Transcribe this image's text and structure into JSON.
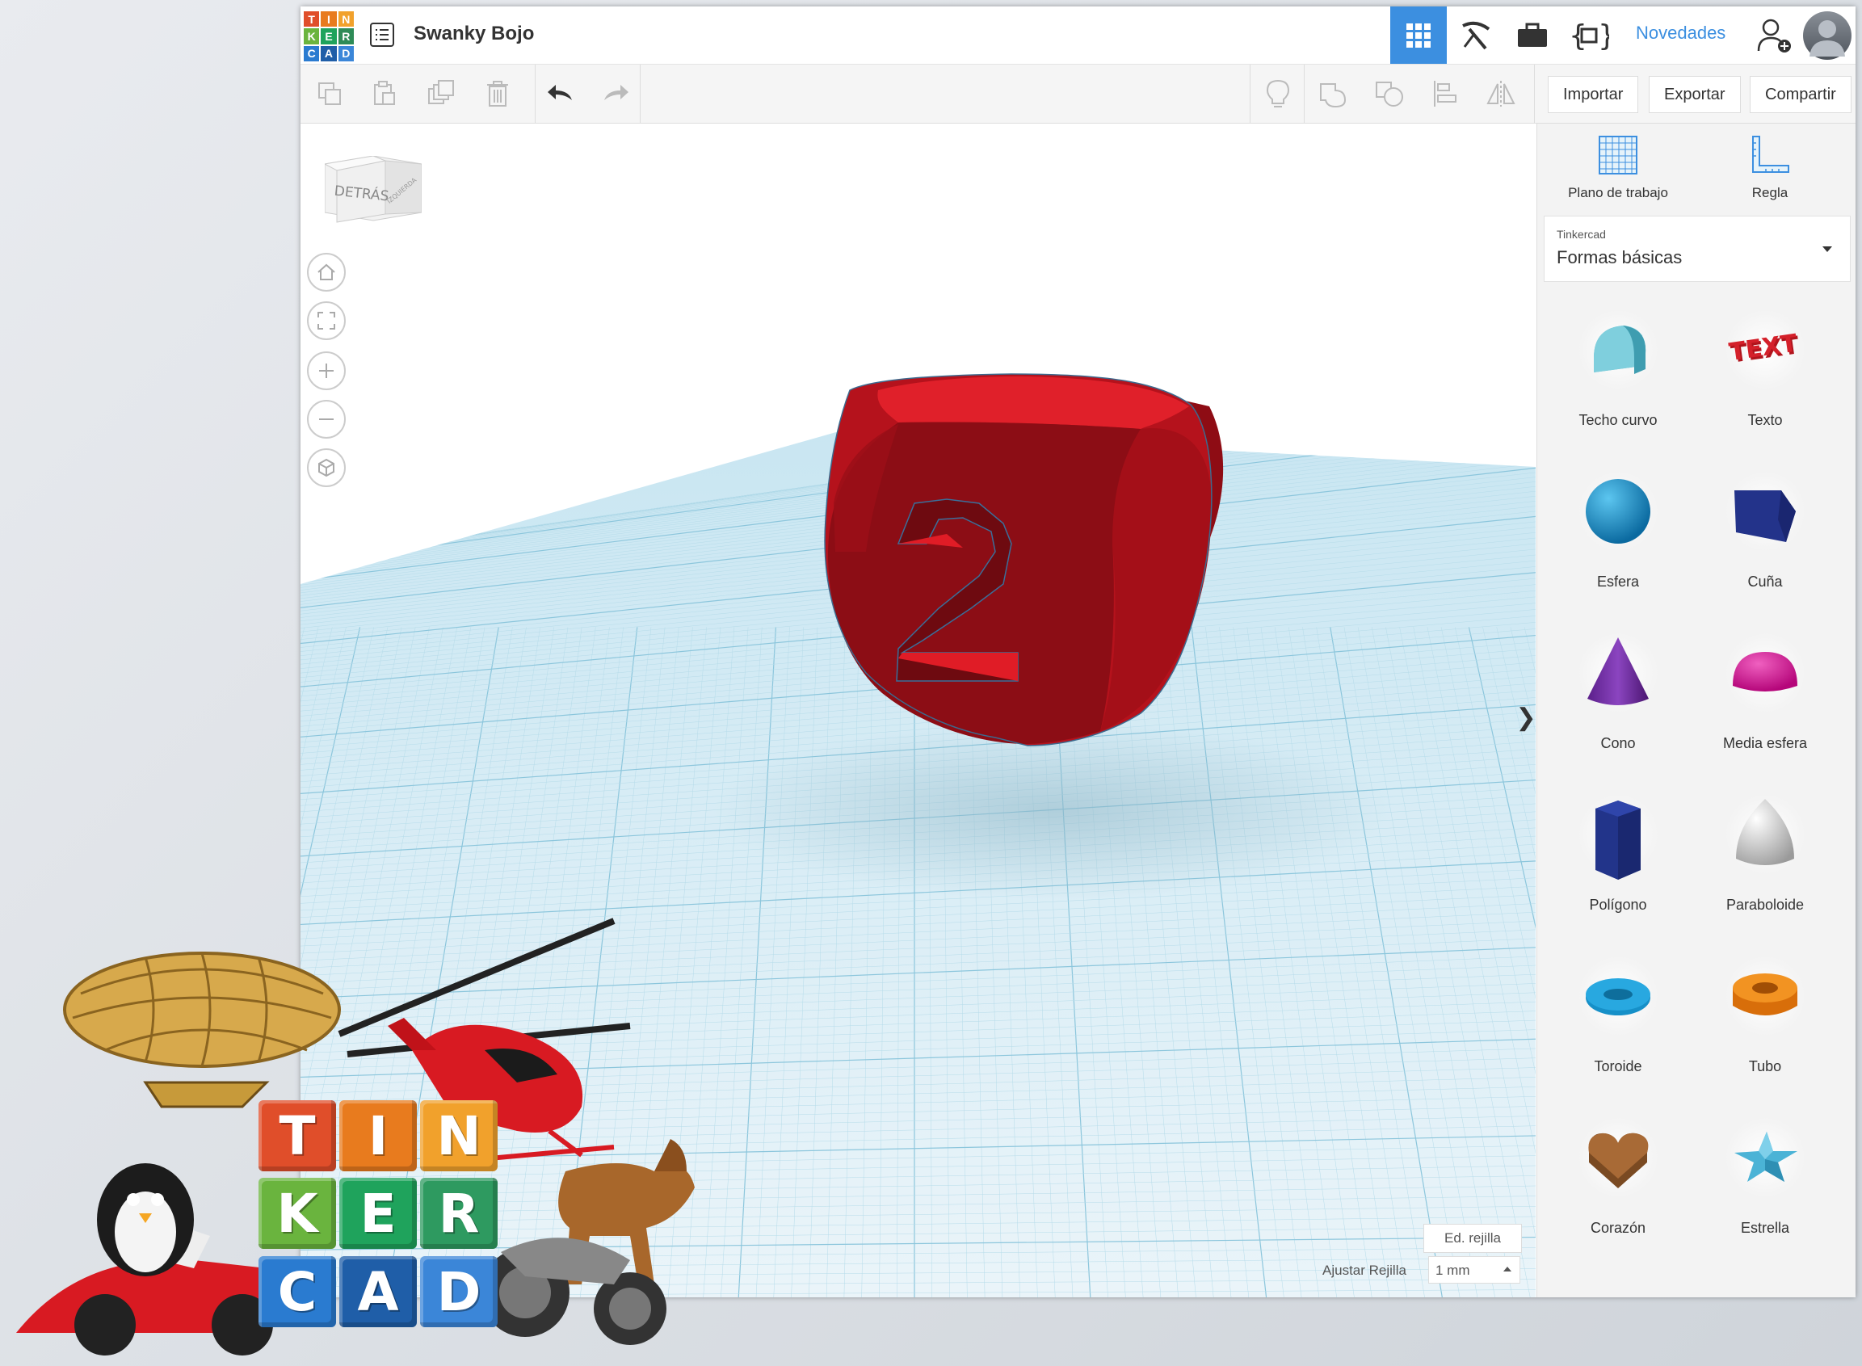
{
  "header": {
    "logo_letters": [
      "T",
      "I",
      "N",
      "K",
      "E",
      "R",
      "C",
      "A",
      "D"
    ],
    "logo_colors": [
      "#e04e2a",
      "#e87b1e",
      "#f1a12c",
      "#6ab43e",
      "#1fa35c",
      "#2e8b57",
      "#2a7bd0",
      "#1f5ea8",
      "#3b86d8"
    ],
    "design_title": "Swanky Bojo",
    "news_label": "Novedades",
    "active_color": "#3c8fe0"
  },
  "toolbar": {
    "import_label": "Importar",
    "export_label": "Exportar",
    "share_label": "Compartir"
  },
  "viewcube": {
    "back_label": "DETRÁS",
    "side_label": "IZQUIERDA"
  },
  "panel": {
    "workplane_label": "Plano de trabajo",
    "ruler_label": "Regla",
    "library_source": "Tinkercad",
    "library_name": "Formas básicas",
    "shapes": [
      {
        "label": "Techo curvo",
        "icon": "roof-icon"
      },
      {
        "label": "Texto",
        "icon": "text-icon"
      },
      {
        "label": "Esfera",
        "icon": "sphere-icon"
      },
      {
        "label": "Cuña",
        "icon": "wedge-icon"
      },
      {
        "label": "Cono",
        "icon": "cone-icon"
      },
      {
        "label": "Media esfera",
        "icon": "half-sphere-icon"
      },
      {
        "label": "Polígono",
        "icon": "polygon-icon"
      },
      {
        "label": "Paraboloide",
        "icon": "paraboloid-icon"
      },
      {
        "label": "Toroide",
        "icon": "torus-icon"
      },
      {
        "label": "Tubo",
        "icon": "tube-icon"
      },
      {
        "label": "Corazón",
        "icon": "heart-icon"
      },
      {
        "label": "Estrella",
        "icon": "star-icon"
      }
    ]
  },
  "viewport": {
    "model_digit": "2",
    "model_color": "#c8141e",
    "grid_edit_label": "Ed. rejilla",
    "snap_label": "Ajustar Rejilla",
    "snap_value": "1 mm",
    "collapse_glyph": "❯"
  },
  "collage": {
    "letters": [
      "T",
      "I",
      "N",
      "K",
      "E",
      "R",
      "C",
      "A",
      "D"
    ]
  }
}
